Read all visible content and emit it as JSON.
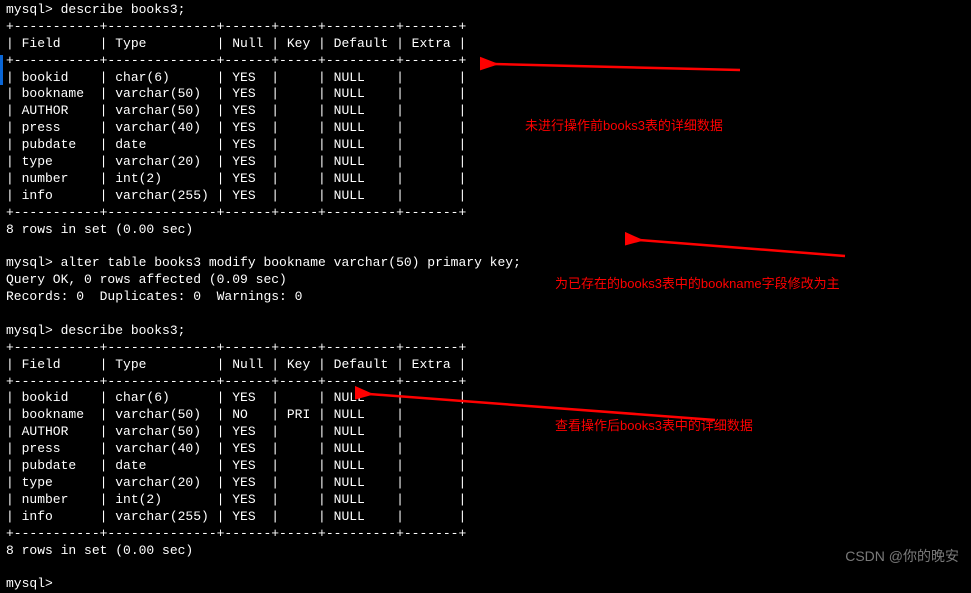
{
  "prompt1": "mysql> describe books3;",
  "table1": {
    "divider": "+-----------+--------------+------+-----+---------+-------+",
    "header": "| Field     | Type         | Null | Key | Default | Extra |",
    "headers": [
      "Field",
      "Type",
      "Null",
      "Key",
      "Default",
      "Extra"
    ],
    "rows": [
      {
        "field": "bookid",
        "type": "char(6)",
        "null": "YES",
        "key": "",
        "default": "NULL",
        "extra": ""
      },
      {
        "field": "bookname",
        "type": "varchar(50)",
        "null": "YES",
        "key": "",
        "default": "NULL",
        "extra": ""
      },
      {
        "field": "AUTHOR",
        "type": "varchar(50)",
        "null": "YES",
        "key": "",
        "default": "NULL",
        "extra": ""
      },
      {
        "field": "press",
        "type": "varchar(40)",
        "null": "YES",
        "key": "",
        "default": "NULL",
        "extra": ""
      },
      {
        "field": "pubdate",
        "type": "date",
        "null": "YES",
        "key": "",
        "default": "NULL",
        "extra": ""
      },
      {
        "field": "type",
        "type": "varchar(20)",
        "null": "YES",
        "key": "",
        "default": "NULL",
        "extra": ""
      },
      {
        "field": "number",
        "type": "int(2)",
        "null": "YES",
        "key": "",
        "default": "NULL",
        "extra": ""
      },
      {
        "field": "info",
        "type": "varchar(255)",
        "null": "YES",
        "key": "",
        "default": "NULL",
        "extra": ""
      }
    ],
    "footer": "8 rows in set (0.00 sec)"
  },
  "prompt2": "mysql> alter table books3 modify bookname varchar(50) primary key;",
  "result2_line1": "Query OK, 0 rows affected (0.09 sec)",
  "result2_line2": "Records: 0  Duplicates: 0  Warnings: 0",
  "prompt3": "mysql> describe books3;",
  "table2": {
    "divider": "+-----------+--------------+------+-----+---------+-------+",
    "header": "| Field     | Type         | Null | Key | Default | Extra |",
    "headers": [
      "Field",
      "Type",
      "Null",
      "Key",
      "Default",
      "Extra"
    ],
    "rows": [
      {
        "field": "bookid",
        "type": "char(6)",
        "null": "YES",
        "key": "",
        "default": "NULL",
        "extra": ""
      },
      {
        "field": "bookname",
        "type": "varchar(50)",
        "null": "NO",
        "key": "PRI",
        "default": "NULL",
        "extra": ""
      },
      {
        "field": "AUTHOR",
        "type": "varchar(50)",
        "null": "YES",
        "key": "",
        "default": "NULL",
        "extra": ""
      },
      {
        "field": "press",
        "type": "varchar(40)",
        "null": "YES",
        "key": "",
        "default": "NULL",
        "extra": ""
      },
      {
        "field": "pubdate",
        "type": "date",
        "null": "YES",
        "key": "",
        "default": "NULL",
        "extra": ""
      },
      {
        "field": "type",
        "type": "varchar(20)",
        "null": "YES",
        "key": "",
        "default": "NULL",
        "extra": ""
      },
      {
        "field": "number",
        "type": "int(2)",
        "null": "YES",
        "key": "",
        "default": "NULL",
        "extra": ""
      },
      {
        "field": "info",
        "type": "varchar(255)",
        "null": "YES",
        "key": "",
        "default": "NULL",
        "extra": ""
      }
    ],
    "footer": "8 rows in set (0.00 sec)"
  },
  "prompt4": "mysql>",
  "annotations": {
    "a1": "未进行操作前books3表的详细数据",
    "a2": "为已存在的books3表中的bookname字段修改为主",
    "a3": "查看操作后books3表中的详细数据"
  },
  "watermark": "CSDN @你的晚安"
}
